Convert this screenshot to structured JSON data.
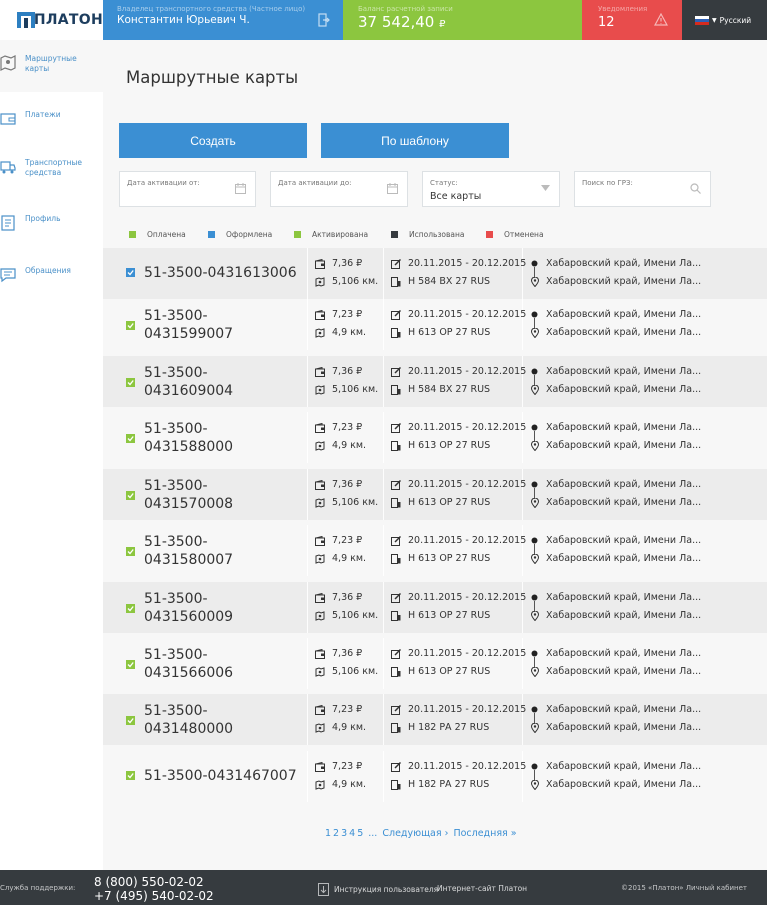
{
  "header": {
    "logo_text": "ПЛАТОН",
    "user_sub": "Владелец транспортного средства (Частное лицо)",
    "user_name": "Константин Юрьевич Ч.",
    "balance_sub": "Баланс расчетной записи",
    "balance_value": "37 542,40",
    "balance_currency": "₽",
    "alert_sub": "Уведомления",
    "alert_count": "12",
    "language": "Русский",
    "colors": {
      "user": "#3b8fd3",
      "balance": "#8cc63f",
      "alert": "#e84c4c",
      "lang": "#363b3f"
    }
  },
  "sidebar": {
    "items": [
      {
        "label": "Маршрутные карты",
        "icon": "map-icon",
        "active": true
      },
      {
        "label": "Платежи",
        "icon": "wallet-icon",
        "active": false
      },
      {
        "label": "Транспортные средства",
        "icon": "truck-icon",
        "active": false
      },
      {
        "label": "Профиль",
        "icon": "profile-icon",
        "active": false
      },
      {
        "label": "Обращения",
        "icon": "chat-icon",
        "active": false
      }
    ]
  },
  "main": {
    "title": "Маршрутные карты",
    "create_label": "Создать",
    "template_label": "По шаблону",
    "filters": {
      "date_from_label": "Дата активации от:",
      "date_to_label": "Дата активации до:",
      "status_label": "Статус:",
      "status_value": "Все карты",
      "search_label": "Поиск по ГРЗ:"
    },
    "legend": [
      {
        "label": "Оплачена",
        "color": "#8cc63f"
      },
      {
        "label": "Оформлена",
        "color": "#3b8fd3"
      },
      {
        "label": "Активирована",
        "color": "#8cc63f"
      },
      {
        "label": "Использована",
        "color": "#363b3f"
      },
      {
        "label": "Отменена",
        "color": "#e84c4c"
      }
    ],
    "rows": [
      {
        "status_color": "#3b8fd3",
        "num1": "51-3500-0431613006",
        "num2": "",
        "price": "7,36 ₽",
        "dist": "5,106 км.",
        "dates": "20.11.2015 - 20.12.2015",
        "plate": "Н 584 ВХ 27 RUS",
        "from": "Хабаровский край, Имени Ла...",
        "to": "Хабаровский край, Имени Ла..."
      },
      {
        "status_color": "#8cc63f",
        "num1": "51-3500-",
        "num2": "0431599007",
        "price": "7,23 ₽",
        "dist": "4,9 км.",
        "dates": "20.11.2015 - 20.12.2015",
        "plate": "Н 613 ОР 27 RUS",
        "from": "Хабаровский край, Имени Ла...",
        "to": "Хабаровский край, Имени Ла..."
      },
      {
        "status_color": "#8cc63f",
        "num1": "51-3500-",
        "num2": "0431609004",
        "price": "7,36 ₽",
        "dist": "5,106 км.",
        "dates": "20.11.2015 - 20.12.2015",
        "plate": "Н 584 ВХ 27 RUS",
        "from": "Хабаровский край, Имени Ла...",
        "to": "Хабаровский край, Имени Ла..."
      },
      {
        "status_color": "#8cc63f",
        "num1": "51-3500-",
        "num2": "0431588000",
        "price": "7,23 ₽",
        "dist": "4,9 км.",
        "dates": "20.11.2015 - 20.12.2015",
        "plate": "Н 613 ОР 27 RUS",
        "from": "Хабаровский край, Имени Ла...",
        "to": "Хабаровский край, Имени Ла..."
      },
      {
        "status_color": "#8cc63f",
        "num1": "51-3500-",
        "num2": "0431570008",
        "price": "7,36 ₽",
        "dist": "5,106 км.",
        "dates": "20.11.2015 - 20.12.2015",
        "plate": "Н 613 ОР 27 RUS",
        "from": "Хабаровский край, Имени Ла...",
        "to": "Хабаровский край, Имени Ла..."
      },
      {
        "status_color": "#8cc63f",
        "num1": "51-3500-",
        "num2": "0431580007",
        "price": "7,23 ₽",
        "dist": "4,9 км.",
        "dates": "20.11.2015 - 20.12.2015",
        "plate": "Н 613 ОР 27 RUS",
        "from": "Хабаровский край, Имени Ла...",
        "to": "Хабаровский край, Имени Ла..."
      },
      {
        "status_color": "#8cc63f",
        "num1": "51-3500-",
        "num2": "0431560009",
        "price": "7,36 ₽",
        "dist": "5,106 км.",
        "dates": "20.11.2015 - 20.12.2015",
        "plate": "Н 613 ОР 27 RUS",
        "from": "Хабаровский край, Имени Ла...",
        "to": "Хабаровский край, Имени Ла..."
      },
      {
        "status_color": "#8cc63f",
        "num1": "51-3500-",
        "num2": "0431566006",
        "price": "7,36 ₽",
        "dist": "5,106 км.",
        "dates": "20.11.2015 - 20.12.2015",
        "plate": "Н 613 ОР 27 RUS",
        "from": "Хабаровский край, Имени Ла...",
        "to": "Хабаровский край, Имени Ла..."
      },
      {
        "status_color": "#8cc63f",
        "num1": "51-3500-",
        "num2": "0431480000",
        "price": "7,23 ₽",
        "dist": "4,9 км.",
        "dates": "20.11.2015 - 20.12.2015",
        "plate": "Н 182 РА 27 RUS",
        "from": "Хабаровский край, Имени Ла...",
        "to": "Хабаровский край, Имени Ла..."
      },
      {
        "status_color": "#8cc63f",
        "num1": "51-3500-0431467007",
        "num2": "",
        "price": "7,23 ₽",
        "dist": "4,9 км.",
        "dates": "20.11.2015 - 20.12.2015",
        "plate": "Н 182 РА 27 RUS",
        "from": "Хабаровский край, Имени Ла...",
        "to": "Хабаровский край, Имени Ла..."
      }
    ],
    "pager": {
      "pages": [
        "1",
        "2",
        "3",
        "4",
        "5"
      ],
      "ellipsis": "...",
      "next": "Следующая ›",
      "last": "Последняя »"
    }
  },
  "footer": {
    "support_label": "Служба поддержки:",
    "phone1": "8 (800) 550-02-02",
    "phone2": "+7 (495) 540-02-02",
    "manual": "Инструкция пользователя",
    "site": "Интернет-сайт Платон",
    "copyright": "©2015 «Платон» Личный кабинет"
  }
}
